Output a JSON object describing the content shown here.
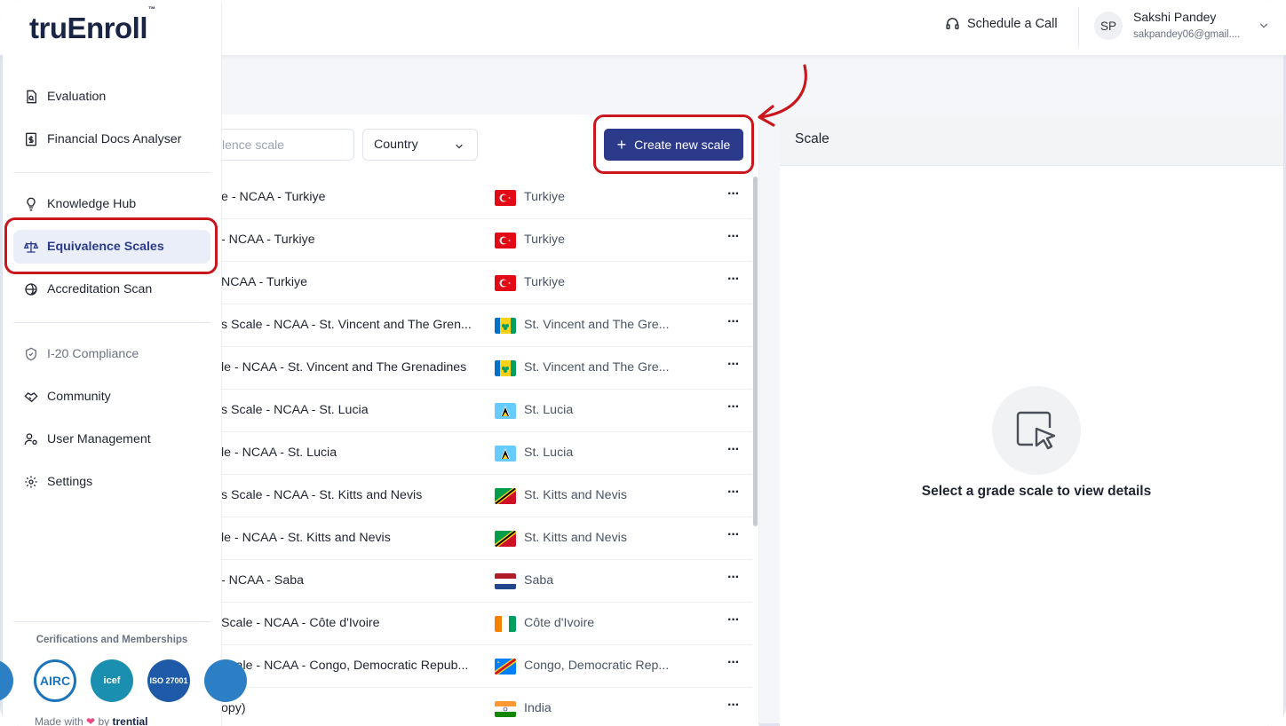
{
  "brand": {
    "logo": "truEnroll",
    "tm": "™"
  },
  "header": {
    "schedule_label": "Schedule a Call",
    "user_initials": "SP",
    "user_name": "Sakshi Pandey",
    "user_email": "sakpandey06@gmail...."
  },
  "sidebar": {
    "items": [
      {
        "label": "Evaluation",
        "icon": "document-search-icon"
      },
      {
        "label": "Financial Docs Analyser",
        "icon": "dollar-document-icon"
      },
      {
        "label": "Knowledge Hub",
        "icon": "lightbulb-icon"
      },
      {
        "label": "Equivalence Scales",
        "icon": "scale-icon"
      },
      {
        "label": "Accreditation Scan",
        "icon": "globe-check-icon"
      },
      {
        "label": "I-20 Compliance",
        "icon": "shield-check-icon"
      },
      {
        "label": "Community",
        "icon": "handshake-icon"
      },
      {
        "label": "User Management",
        "icon": "user-settings-icon"
      },
      {
        "label": "Settings",
        "icon": "gear-icon"
      }
    ],
    "active": "Equivalence Scales",
    "certifications_title": "Cerifications and Memberships",
    "badges": [
      "AIRC",
      "icef",
      "ISO 27001"
    ],
    "made_with": "Made with",
    "by": "by",
    "company": "trential"
  },
  "list": {
    "search_placeholder": "lence scale",
    "country_select": "Country",
    "create_label": "Create new scale",
    "rows": [
      {
        "name": "e - NCAA - Turkiye",
        "country": "Turkiye",
        "flag": "turkey"
      },
      {
        "name": "- NCAA - Turkiye",
        "country": "Turkiye",
        "flag": "turkey"
      },
      {
        "name": "NCAA - Turkiye",
        "country": "Turkiye",
        "flag": "turkey"
      },
      {
        "name": "s Scale - NCAA - St. Vincent and The Gren...",
        "country": "St. Vincent and The Gre...",
        "flag": "svg"
      },
      {
        "name": "le - NCAA - St. Vincent and The Grenadines",
        "country": "St. Vincent and The Gre...",
        "flag": "svg"
      },
      {
        "name": "s Scale - NCAA - St. Lucia",
        "country": "St. Lucia",
        "flag": "lucia"
      },
      {
        "name": "le - NCAA - St. Lucia",
        "country": "St. Lucia",
        "flag": "lucia"
      },
      {
        "name": "s Scale - NCAA - St. Kitts and Nevis",
        "country": "St. Kitts and Nevis",
        "flag": "kitts"
      },
      {
        "name": "le - NCAA - St. Kitts and Nevis",
        "country": "St. Kitts and Nevis",
        "flag": "kitts"
      },
      {
        "name": "- NCAA - Saba",
        "country": "Saba",
        "flag": "saba"
      },
      {
        "name": "Scale - NCAA - Côte d'Ivoire",
        "country": "Côte d'Ivoire",
        "flag": "ivory"
      },
      {
        "name": "Scale - NCAA - Congo, Democratic Repub...",
        "country": "Congo, Democratic Rep...",
        "flag": "congo"
      },
      {
        "name": "opy)",
        "country": "India",
        "flag": "india"
      }
    ],
    "more_label": "···"
  },
  "detail": {
    "title": "Scale",
    "empty_message": "Select a grade scale to view details"
  },
  "colors": {
    "accent": "#2c3a8c",
    "highlight": "#c8181e"
  }
}
